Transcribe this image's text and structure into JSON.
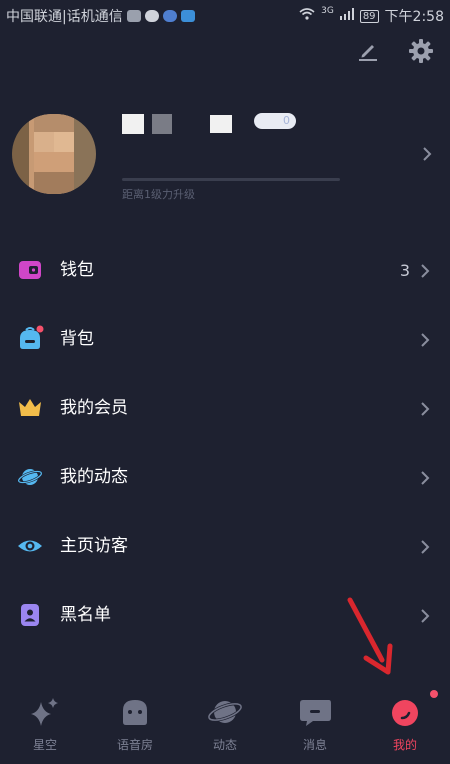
{
  "status_bar": {
    "carrier": "中国联通|话机通信",
    "network": "3G",
    "battery": "89",
    "time": "下午2:58"
  },
  "profile": {
    "level_badge": "0",
    "progress_text": "距离1级力升级"
  },
  "menu": [
    {
      "label": "钱包",
      "value": "3",
      "icon": "wallet-icon",
      "color": "#d046c8"
    },
    {
      "label": "背包",
      "value": "",
      "icon": "backpack-icon",
      "color": "#55b8f0",
      "badge": true
    },
    {
      "label": "我的会员",
      "value": "",
      "icon": "crown-icon",
      "color": "#f2bd4a"
    },
    {
      "label": "我的动态",
      "value": "",
      "icon": "planet-icon",
      "color": "#55b8f0"
    },
    {
      "label": "主页访客",
      "value": "",
      "icon": "eye-icon",
      "color": "#55b8f0"
    },
    {
      "label": "黑名单",
      "value": "",
      "icon": "blacklist-icon",
      "color": "#9b86f0"
    }
  ],
  "tabs": [
    {
      "label": "星空",
      "icon": "sparkle-icon"
    },
    {
      "label": "语音房",
      "icon": "voice-room-icon"
    },
    {
      "label": "动态",
      "icon": "planet-icon"
    },
    {
      "label": "消息",
      "icon": "message-icon"
    },
    {
      "label": "我的",
      "icon": "profile-icon",
      "active": true
    }
  ],
  "colors": {
    "background": "#1e2130",
    "accent": "#f0455f",
    "muted": "#7d8194"
  }
}
